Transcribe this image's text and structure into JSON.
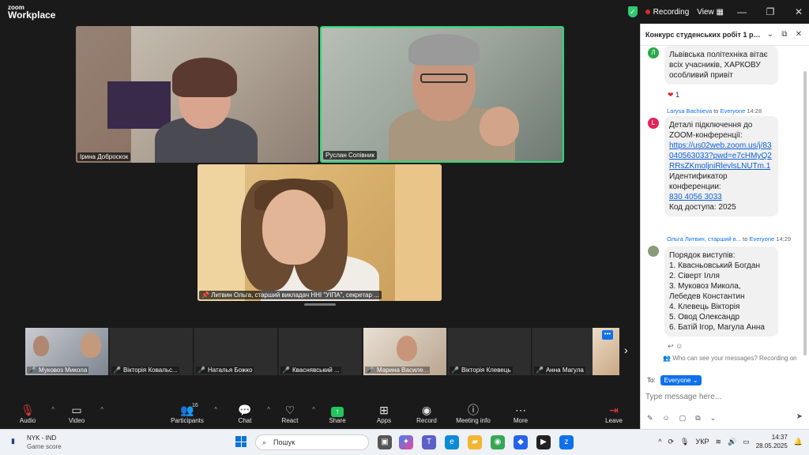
{
  "app": {
    "brand_small": "zoom",
    "brand_big": "Workplace",
    "recording_label": "Recording",
    "view_label": "View",
    "window_controls": [
      "minimize-icon",
      "restore-icon",
      "close-icon"
    ]
  },
  "video": {
    "main_tiles": [
      {
        "name": "Ірина Доброскок"
      },
      {
        "name": "Руслан Сопівник"
      },
      {
        "name": "Литвин Ольга, старший викладач ННІ \"УІПА\", секретар ..."
      }
    ],
    "strip_tiles": [
      {
        "name": "Муковоз Микола"
      },
      {
        "name": "Вікторія Ковальс..."
      },
      {
        "name": "Наталья Божко"
      },
      {
        "name": "Кваснявський ..."
      },
      {
        "name": "Марина Василе..."
      },
      {
        "name": "Вікторія Клевець"
      },
      {
        "name": "Анна Магула"
      }
    ]
  },
  "toolbar": {
    "audio": "Audio",
    "video": "Video",
    "participants": "Participants",
    "participants_count": "16",
    "chat": "Chat",
    "react": "React",
    "share": "Share",
    "apps": "Apps",
    "record": "Record",
    "meeting_info": "Meeting info",
    "more": "More",
    "leave": "Leave"
  },
  "chat": {
    "title": "Конкурс студенських робіт 1 розд...",
    "messages": [
      {
        "avatar": "Л",
        "avatar_color": "#2aa84a",
        "text": "Львівська політехніка вітає всіх учасників, ХАРКОВУ особливий привіт",
        "reaction_count": "1"
      },
      {
        "sender": "Larysa Bachiieva",
        "to": "to",
        "recipient": "Everyone",
        "time": "14:28",
        "avatar": "L",
        "avatar_color": "#e0245e",
        "line1": "Деталі підключення до ZOOM-конференції:",
        "link": "https://us02web.zoom.us/j/83040563033?pwd=e7cHMyQ2RRsZKmoljniRlevlsLNUTm.1",
        "line2": "Идентификатор конференции:",
        "conf_id": "830 4056 3033",
        "line3": "Код доступа: 2025"
      },
      {
        "sender": "Ольга Литвин, старший в...",
        "to": "to",
        "recipient": "Everyone",
        "time": "14:29",
        "lines": [
          "Порядок виступів:",
          "1. Квасньовський Богдан",
          "2. Сіверт Ілля",
          "3. Муковоз Микола, Лебедев Константин",
          "4. Клевець Вікторія",
          "5. Овод Олександр",
          "6. Батій Ігор, Магула Анна"
        ]
      }
    ],
    "notice": "Who can see your messages? Recording on",
    "to_label": "To:",
    "everyone": "Everyone",
    "placeholder": "Type message here..."
  },
  "taskbar": {
    "news_title": "NYK - IND",
    "news_sub": "Game score",
    "search_placeholder": "Пошук",
    "lang": "УКР",
    "time": "14:37",
    "date": "28.05.2025"
  },
  "colors": {
    "accent": "#0e71eb",
    "active_speaker": "#2bd97c",
    "leave": "#e03a3a",
    "share": "#22c55e"
  }
}
